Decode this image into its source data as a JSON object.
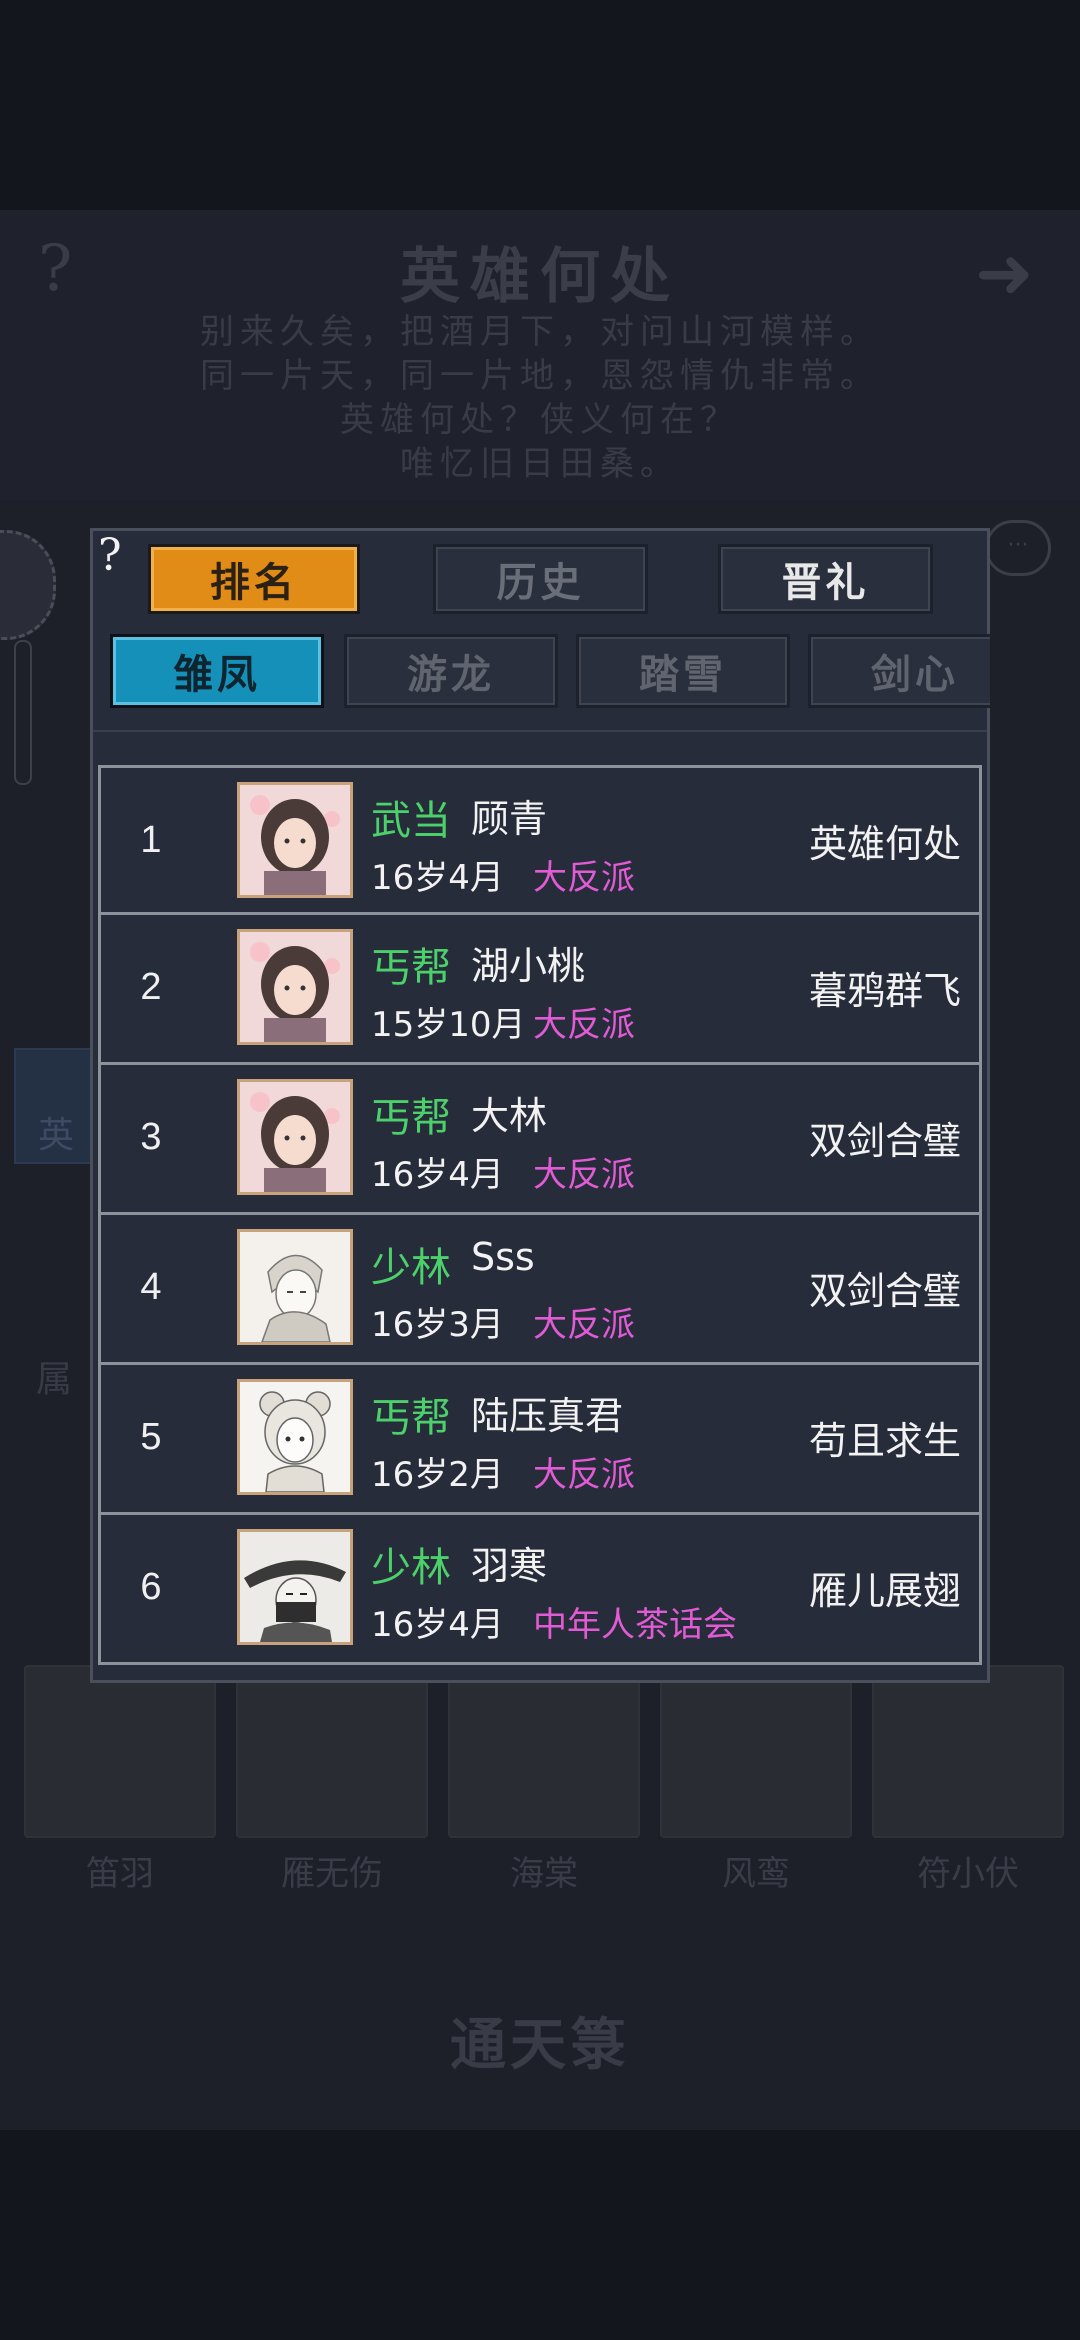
{
  "background": {
    "help_symbol": "?",
    "title": "英雄何处",
    "poem": [
      "别来久矣，把酒月下，对问山河模样。",
      "同一片天，同一片地，恩怨情仇非常。",
      "英雄何处？侠义何在？",
      "唯忆旧日田桑。"
    ],
    "side_tab_label": "英",
    "side_label": "属",
    "heroes": [
      {
        "name": "笛羽"
      },
      {
        "name": "雁无伤"
      },
      {
        "name": "海棠"
      },
      {
        "name": "风鸾"
      },
      {
        "name": "符小伏"
      }
    ],
    "bottom_title": "通天箓"
  },
  "dialog": {
    "help_symbol": "?",
    "tabs": {
      "rank": "排名",
      "history": "历史",
      "ceremony": "晋礼"
    },
    "sub_tabs": {
      "t1": "雏凤",
      "t2": "游龙",
      "t3": "踏雪",
      "t4": "剑心"
    },
    "rows": [
      {
        "rank": "1",
        "sect": "武当",
        "name": "顾青",
        "age": "16岁4月",
        "faction": "大反派",
        "title": "英雄何处",
        "avatar": "female-portrait-icon"
      },
      {
        "rank": "2",
        "sect": "丐帮",
        "name": "湖小桃",
        "age": "15岁10月",
        "faction": "大反派",
        "title": "暮鸦群飞",
        "avatar": "female-portrait-icon"
      },
      {
        "rank": "3",
        "sect": "丐帮",
        "name": "大林",
        "age": "16岁4月",
        "faction": "大反派",
        "title": "双剑合璧",
        "avatar": "female-portrait-icon"
      },
      {
        "rank": "4",
        "sect": "少林",
        "name": "Sss",
        "age": "16岁3月",
        "faction": "大反派",
        "title": "双剑合璧",
        "avatar": "male-sketch-portrait-icon"
      },
      {
        "rank": "5",
        "sect": "丐帮",
        "name": "陆压真君",
        "age": "16岁2月",
        "faction": "大反派",
        "title": "苟且求生",
        "avatar": "girl-sketch-portrait-icon"
      },
      {
        "rank": "6",
        "sect": "少林",
        "name": "羽寒",
        "age": "16岁4月",
        "faction": "中年人茶话会",
        "title": "雁儿展翅",
        "avatar": "masked-hat-portrait-icon"
      }
    ]
  },
  "colors": {
    "rank_tab": "#e08c16",
    "sub_tab_active": "#1590b8",
    "sect_green": "#4bd06a",
    "faction_pink": "#e05bd4",
    "panel": "#272c3a"
  }
}
